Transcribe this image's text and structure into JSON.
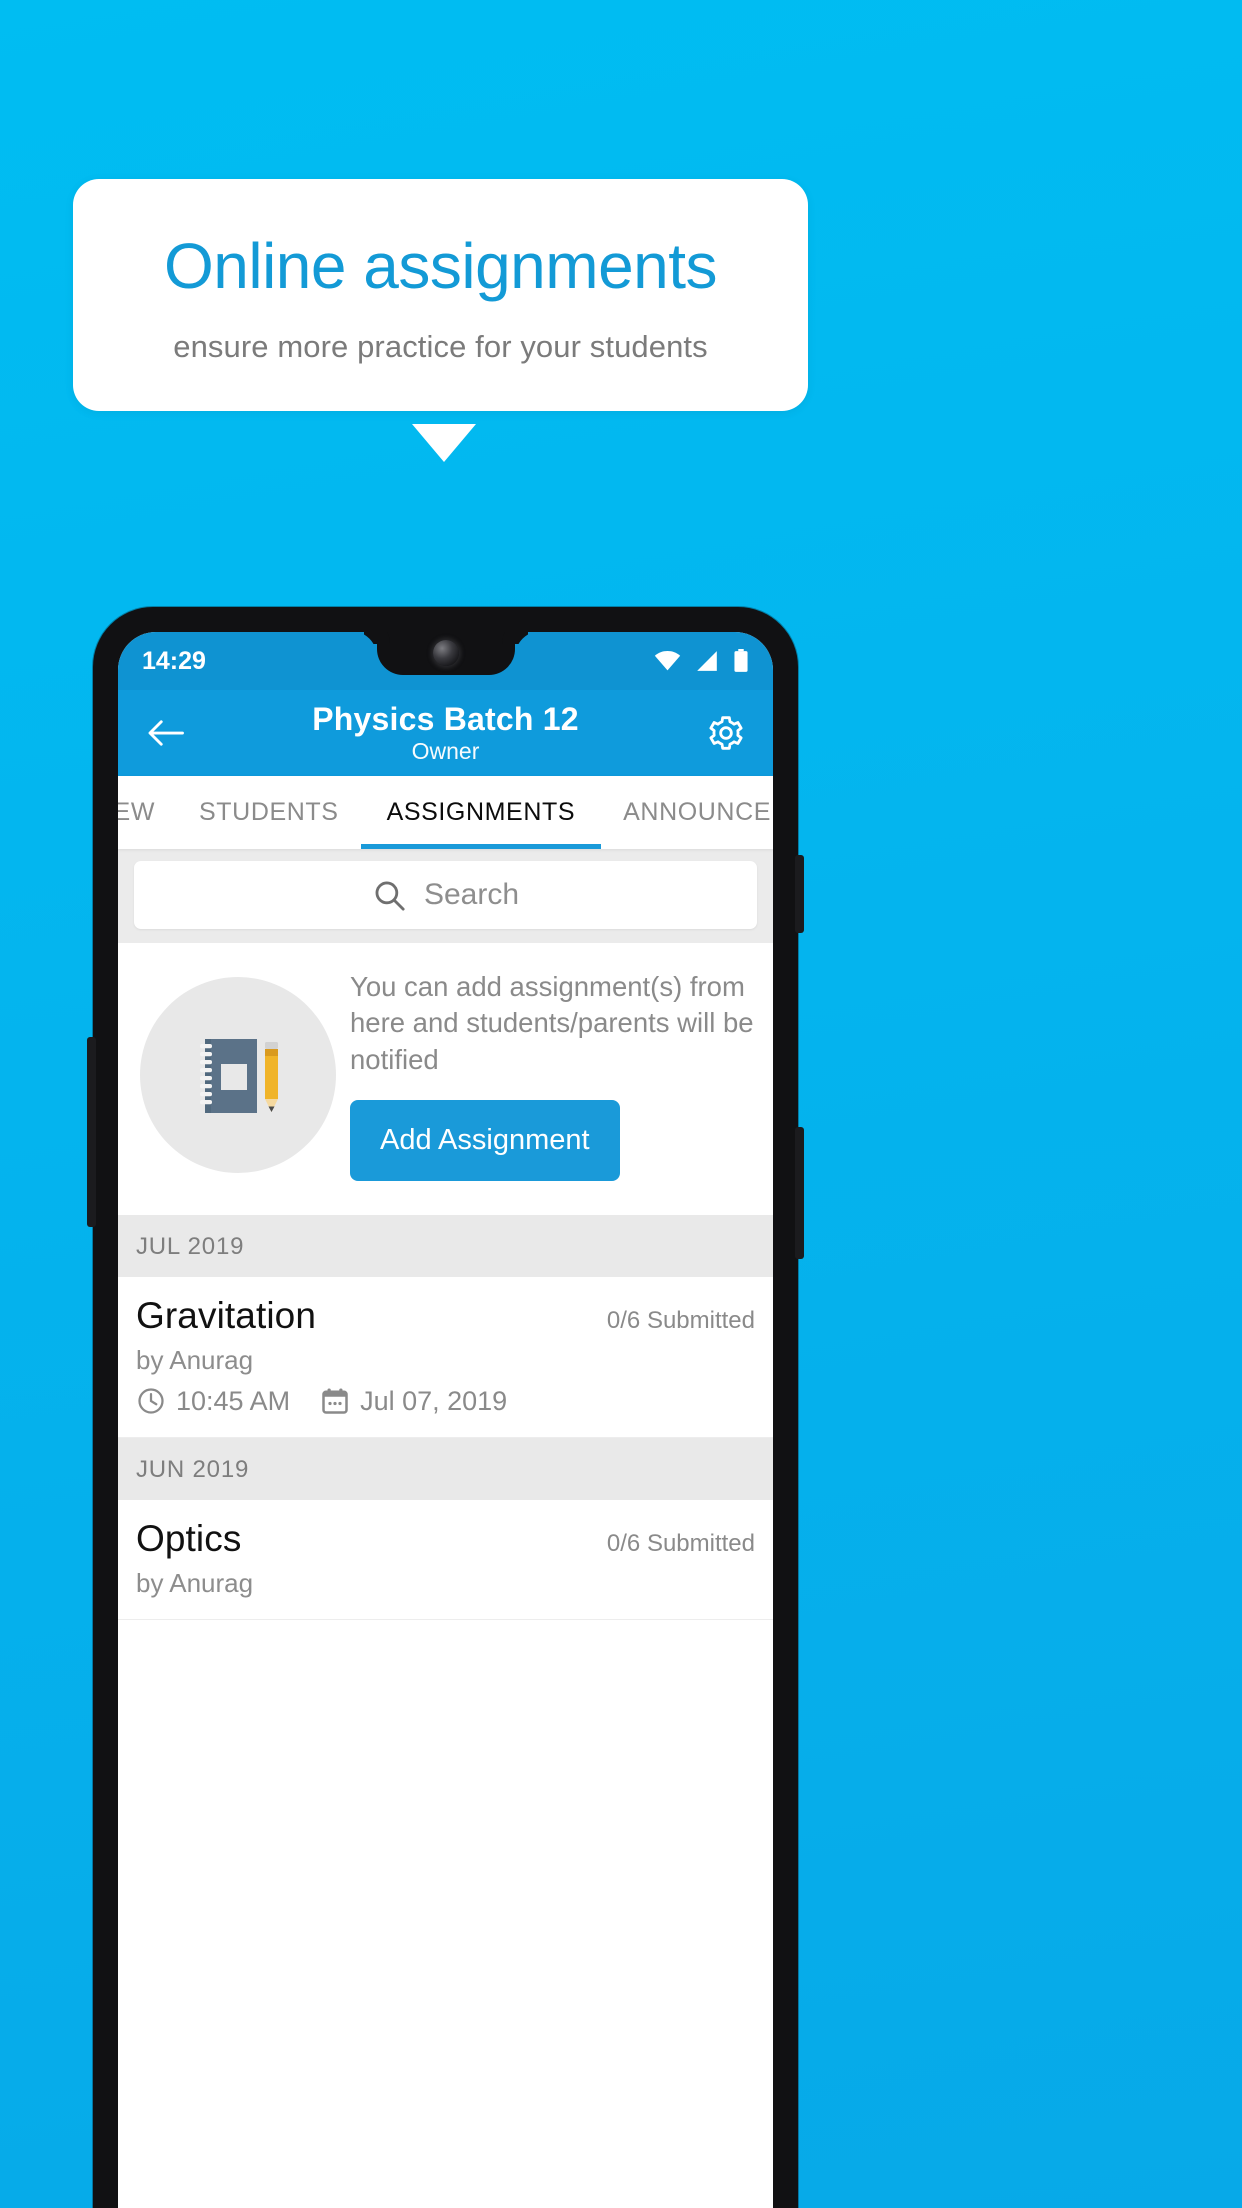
{
  "promo": {
    "title": "Online assignments",
    "subtitle": "ensure more practice for your students"
  },
  "colors": {
    "background": "#00b6ef",
    "accent": "#1a9ad9",
    "appbar": "#0f9bdc",
    "statusbar": "#0f93d2",
    "title_blue": "#139ad6",
    "notebook": "#5b7288",
    "pencil": "#f0b429"
  },
  "phone": {
    "status_bar": {
      "time": "14:29",
      "icons": [
        "wifi-icon",
        "signal-icon",
        "battery-icon"
      ]
    },
    "app_bar": {
      "back_icon": "back-arrow-icon",
      "title": "Physics Batch 12",
      "subtitle": "Owner",
      "settings_icon": "gear-icon"
    },
    "tabs": [
      {
        "label": "IEW",
        "active": false
      },
      {
        "label": "STUDENTS",
        "active": false
      },
      {
        "label": "ASSIGNMENTS",
        "active": true
      },
      {
        "label": "ANNOUNCEMEN",
        "active": false
      }
    ],
    "search": {
      "icon": "search-icon",
      "placeholder": "Search",
      "value": ""
    },
    "empty_state": {
      "illustration": "notebook-pencil-icon",
      "message": "You can add assignment(s) from here and students/parents will be notified",
      "button_label": "Add Assignment"
    },
    "sections": [
      {
        "month": "JUL 2019",
        "items": [
          {
            "title": "Gravitation",
            "submitted": "0/6 Submitted",
            "author": "by Anurag",
            "time_icon": "clock-icon",
            "time": "10:45 AM",
            "date_icon": "calendar-icon",
            "date": "Jul 07, 2019"
          }
        ]
      },
      {
        "month": "JUN 2019",
        "items": [
          {
            "title": "Optics",
            "submitted": "0/6 Submitted",
            "author": "by Anurag",
            "time_icon": "clock-icon",
            "time": "",
            "date_icon": "calendar-icon",
            "date": ""
          }
        ]
      }
    ]
  }
}
